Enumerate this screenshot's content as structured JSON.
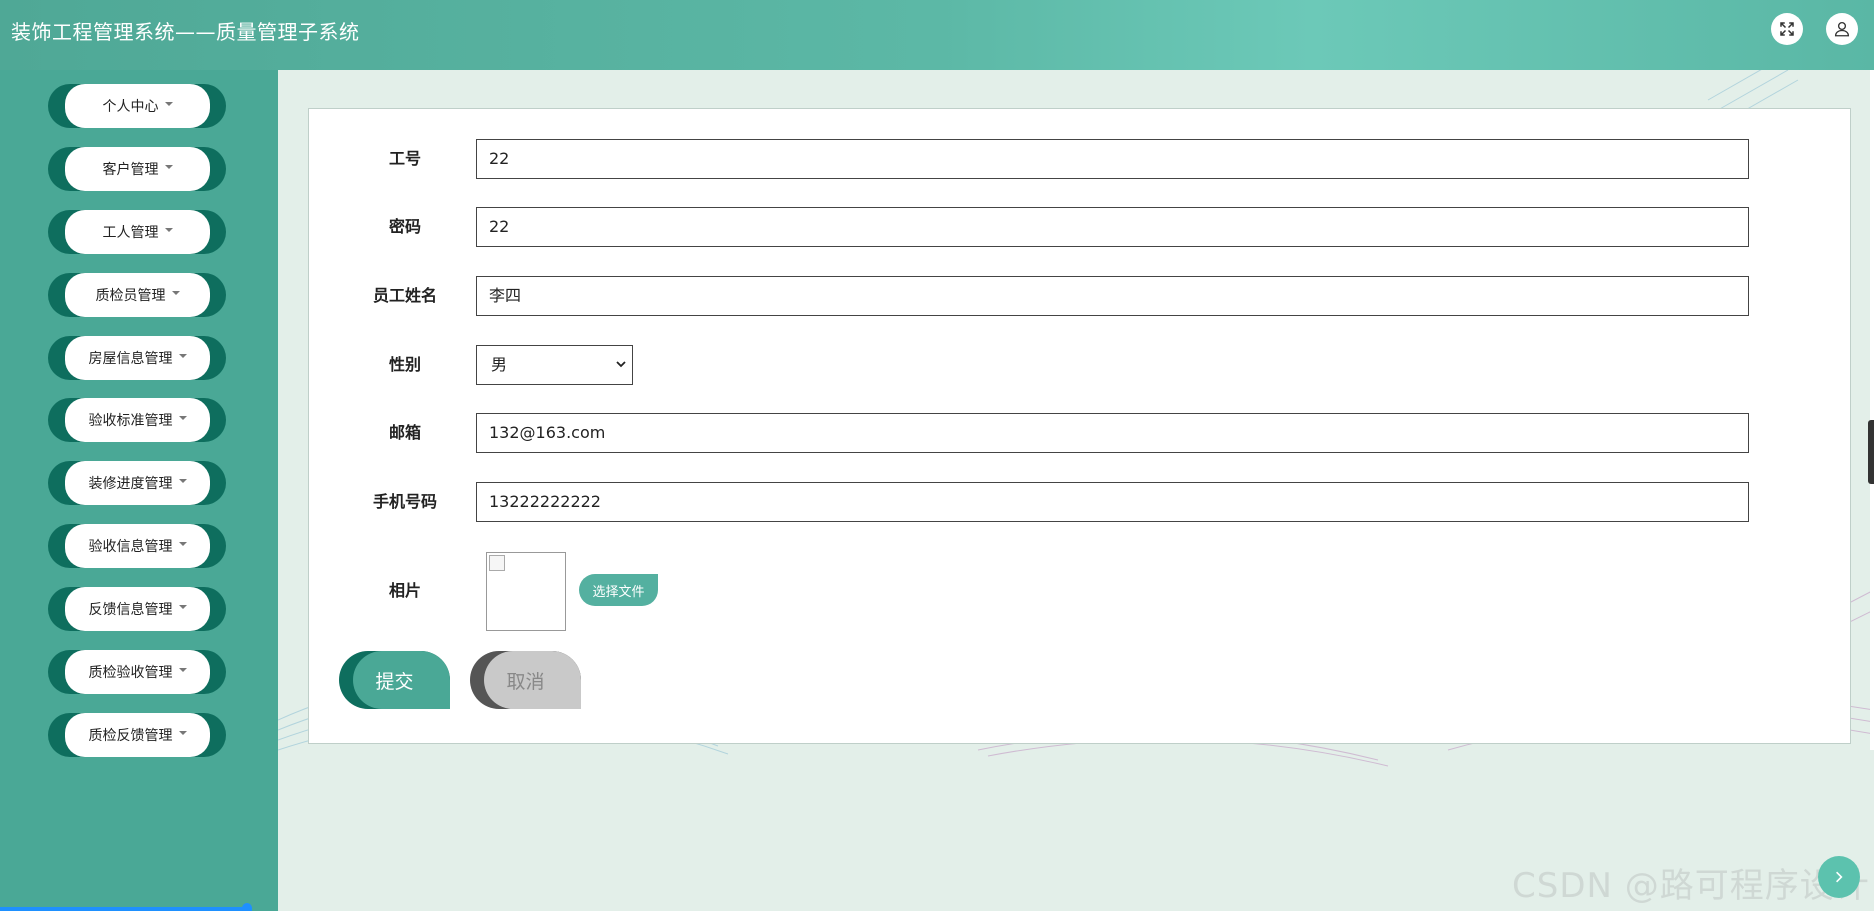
{
  "header": {
    "title": "装饰工程管理系统——质量管理子系统",
    "fullscreen_icon": "fullscreen-icon",
    "user_icon": "user-icon"
  },
  "sidebar": {
    "items": [
      {
        "label": "个人中心"
      },
      {
        "label": "客户管理"
      },
      {
        "label": "工人管理"
      },
      {
        "label": "质检员管理"
      },
      {
        "label": "房屋信息管理"
      },
      {
        "label": "验收标准管理"
      },
      {
        "label": "装修进度管理"
      },
      {
        "label": "验收信息管理"
      },
      {
        "label": "反馈信息管理"
      },
      {
        "label": "质检验收管理"
      },
      {
        "label": "质检反馈管理"
      }
    ]
  },
  "form": {
    "fields": [
      {
        "label": "工号",
        "value": "22"
      },
      {
        "label": "密码",
        "value": "22"
      },
      {
        "label": "员工姓名",
        "value": "李四"
      },
      {
        "label": "性别",
        "value": "男"
      },
      {
        "label": "邮箱",
        "value": "132@163.com"
      },
      {
        "label": "手机号码",
        "value": "13222222222"
      },
      {
        "label": "相片"
      }
    ],
    "file_button": "选择文件",
    "submit_label": "提交",
    "cancel_label": "取消"
  },
  "watermark": "CSDN @路可程序设计",
  "colors": {
    "primary": "#4aa896",
    "primary_dark": "#0e6e5e",
    "header_light": "#6cc9b8"
  }
}
